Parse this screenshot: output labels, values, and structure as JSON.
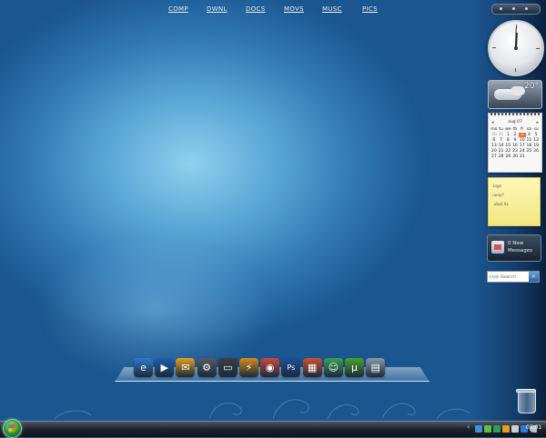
{
  "topbar": {
    "links": [
      "COMP",
      "DWNL",
      "DOCS",
      "MOVS",
      "MUSC",
      "PICS"
    ]
  },
  "gadgets": {
    "weather": {
      "temperature": "20°"
    },
    "calendar": {
      "month_label": "aug 07",
      "weekdays": [
        "mo",
        "tu",
        "we",
        "th",
        "fr",
        "sa",
        "su"
      ],
      "days": [
        "30",
        "31",
        "1",
        "2",
        "3",
        "4",
        "5",
        "6",
        "7",
        "8",
        "9",
        "10",
        "11",
        "12",
        "13",
        "14",
        "15",
        "16",
        "17",
        "18",
        "19",
        "20",
        "21",
        "22",
        "23",
        "24",
        "25",
        "26",
        "27",
        "28",
        "29",
        "30",
        "31"
      ],
      "today": "3"
    },
    "notes": {
      "lines": [
        "1ogo",
        "ramp?",
        "dock.fix"
      ]
    },
    "mail": {
      "line1": "0 New",
      "line2": "Messages"
    },
    "search": {
      "placeholder": "Live Search"
    }
  },
  "dock": {
    "items": [
      {
        "name": "internet-explorer-icon",
        "glyph": "e",
        "color": "#2d7bd1"
      },
      {
        "name": "media-player-icon",
        "glyph": "▶",
        "color": "#1c5fb0"
      },
      {
        "name": "media-center-icon",
        "glyph": "✉",
        "color": "#e0a21d"
      },
      {
        "name": "network-tool-icon",
        "glyph": "⚙",
        "color": "#555c63"
      },
      {
        "name": "monitor-icon",
        "glyph": "▭",
        "color": "#3a3f45"
      },
      {
        "name": "lightning-app-icon",
        "glyph": "⚡",
        "color": "#d98a1b"
      },
      {
        "name": "picasa-icon",
        "glyph": "◉",
        "color": "#c84a3e"
      },
      {
        "name": "photoshop-icon",
        "glyph": "Ps",
        "color": "#1d4f9c"
      },
      {
        "name": "games-icon",
        "glyph": "▦",
        "color": "#d0502f"
      },
      {
        "name": "messenger-icon",
        "glyph": "☺",
        "color": "#3aa155"
      },
      {
        "name": "utorrent-icon",
        "glyph": "µ",
        "color": "#4aa52a"
      },
      {
        "name": "calculator-icon",
        "glyph": "▤",
        "color": "#8d9aa8"
      }
    ]
  },
  "taskbar": {
    "time": "05:01"
  }
}
